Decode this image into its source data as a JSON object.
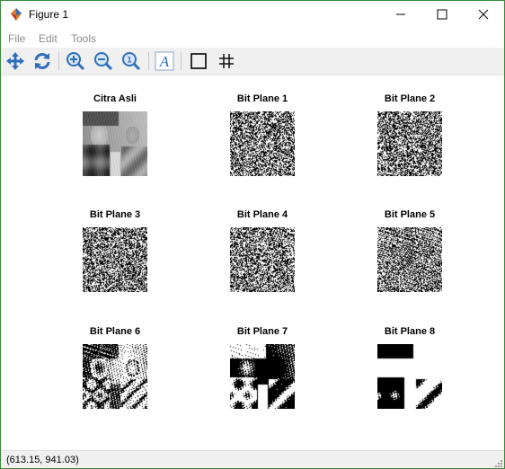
{
  "window": {
    "title": "Figure 1"
  },
  "menu": [
    "File",
    "Edit",
    "Tools"
  ],
  "toolbar": {
    "icons": [
      "pan-icon",
      "rotate-icon",
      "zoom-in-icon",
      "zoom-out-icon",
      "zoom-reset-icon",
      "insert-text-icon",
      "insert-rectangle-icon",
      "grid-icon"
    ]
  },
  "panels": [
    {
      "title": "Citra Asli"
    },
    {
      "title": "Bit Plane 1"
    },
    {
      "title": "Bit Plane 2"
    },
    {
      "title": "Bit Plane 3"
    },
    {
      "title": "Bit Plane 4"
    },
    {
      "title": "Bit Plane 5"
    },
    {
      "title": "Bit Plane 6"
    },
    {
      "title": "Bit Plane 7"
    },
    {
      "title": "Bit Plane 8"
    }
  ],
  "status": {
    "coords": "(613.15, 941.03)"
  },
  "colors": {
    "frame": "#3a8a3a",
    "toolbar_bg": "#f0f0f0",
    "toolbar_icon": "#2f6fba",
    "menu_text": "#8a8a8a"
  }
}
